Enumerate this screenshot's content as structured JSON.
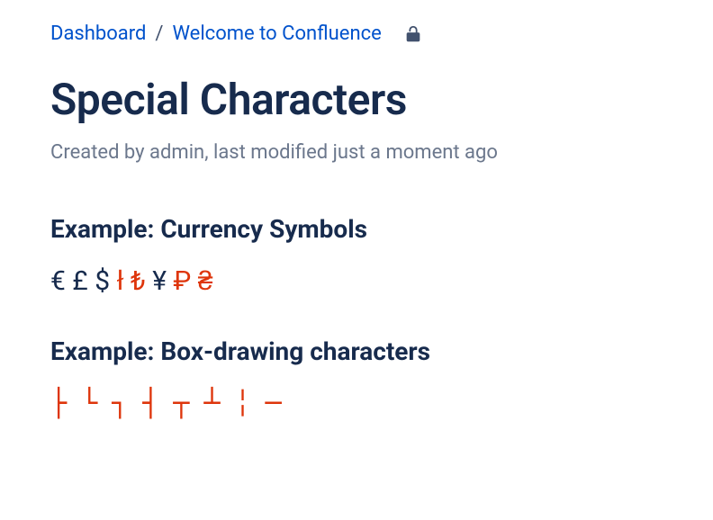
{
  "breadcrumb": {
    "items": [
      {
        "label": "Dashboard"
      },
      {
        "label": "Welcome to Confluence"
      }
    ],
    "separator": "/"
  },
  "page": {
    "title": "Special Characters",
    "meta": "Created by admin, last modified just a moment ago"
  },
  "sections": [
    {
      "heading": "Example: Currency Symbols",
      "runs": [
        {
          "text": "€ £ $ ",
          "class": ""
        },
        {
          "text": "ł ₺",
          "class": "red"
        },
        {
          "text": " ¥ ",
          "class": ""
        },
        {
          "text": "₽ ₴",
          "class": "red"
        }
      ]
    },
    {
      "heading": "Example: Box-drawing characters",
      "chars": [
        "├",
        "└",
        "┐",
        "┤",
        "┬",
        "┴",
        "╎",
        "─"
      ]
    }
  ]
}
